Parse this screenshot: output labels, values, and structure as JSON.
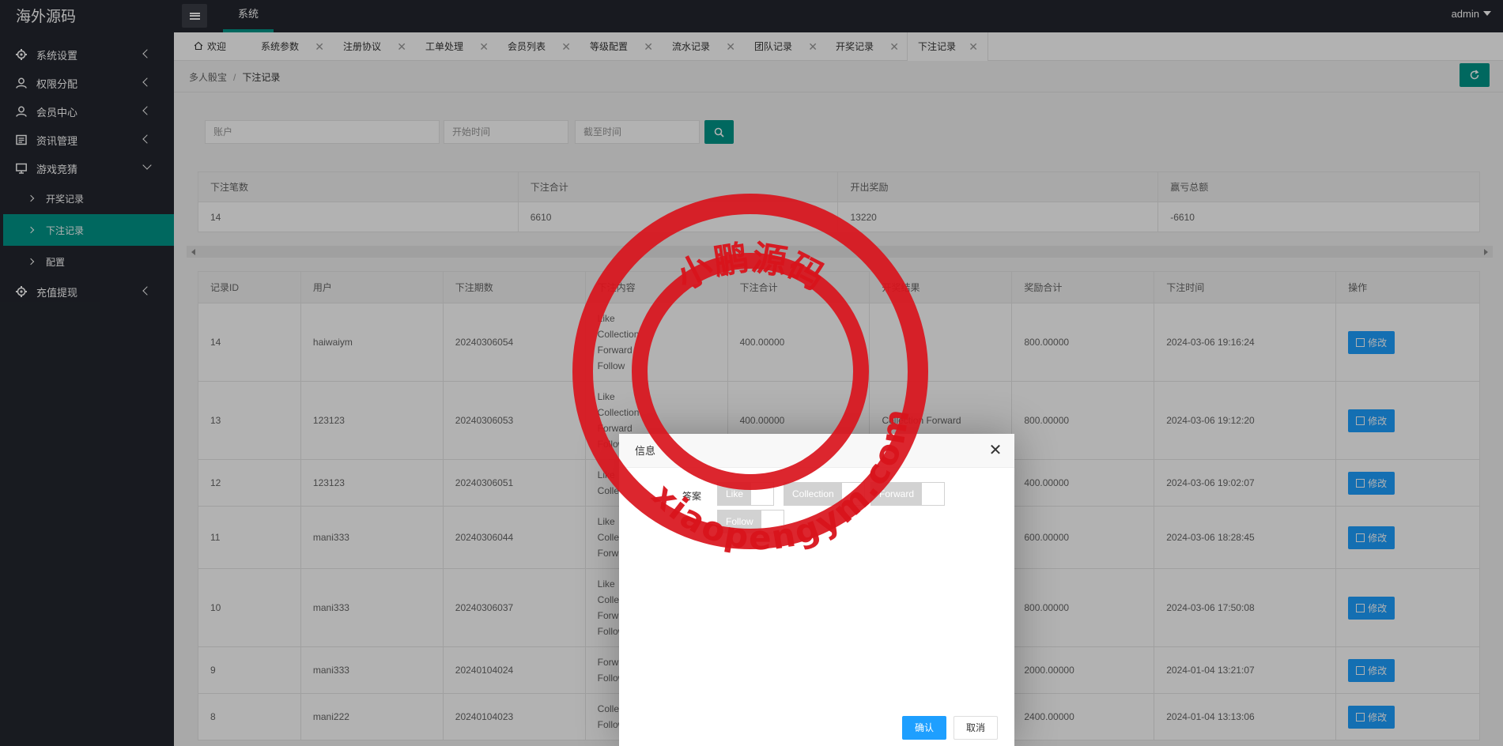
{
  "app": {
    "logo": "海外源码",
    "top_nav": "系统",
    "user": "admin"
  },
  "sidebar": {
    "items": [
      {
        "label": "系统设置",
        "icon": "gear-icon"
      },
      {
        "label": "权限分配",
        "icon": "user-key-icon"
      },
      {
        "label": "会员中心",
        "icon": "user-icon"
      },
      {
        "label": "资讯管理",
        "icon": "news-icon"
      },
      {
        "label": "游戏竞猜",
        "icon": "monitor-icon"
      },
      {
        "label": "充值提现",
        "icon": "gear-icon"
      }
    ],
    "sub_items": [
      {
        "label": "开奖记录"
      },
      {
        "label": "下注记录"
      },
      {
        "label": "配置"
      }
    ]
  },
  "tabs": [
    {
      "label": "欢迎"
    },
    {
      "label": "系统参数"
    },
    {
      "label": "注册协议"
    },
    {
      "label": "工单处理"
    },
    {
      "label": "会员列表"
    },
    {
      "label": "等级配置"
    },
    {
      "label": "流水记录"
    },
    {
      "label": "团队记录"
    },
    {
      "label": "开奖记录"
    },
    {
      "label": "下注记录"
    }
  ],
  "breadcrumb": {
    "parent": "多人骰宝",
    "sep": "/",
    "current": "下注记录"
  },
  "filters": {
    "account_placeholder": "账户",
    "start_placeholder": "开始时间",
    "end_placeholder": "截至时间"
  },
  "summary": {
    "headers": [
      "下注笔数",
      "下注合计",
      "开出奖励",
      "赢亏总额"
    ],
    "values": [
      "14",
      "6610",
      "13220",
      "-6610"
    ]
  },
  "table": {
    "headers": [
      "记录ID",
      "用户",
      "下注期数",
      "下注内容",
      "下注合计",
      "开奖结果",
      "奖励合计",
      "下注时间",
      "操作"
    ],
    "edit_label": "修改",
    "rows": [
      {
        "id": "14",
        "user": "haiwaiym",
        "period": "20240306054",
        "content": [
          "Like",
          "Collection",
          "Forward",
          "Follow"
        ],
        "total": "400.00000",
        "result": "",
        "reward": "800.00000",
        "time": "2024-03-06 19:16:24"
      },
      {
        "id": "13",
        "user": "123123",
        "period": "20240306053",
        "content": [
          "Like",
          "Collection",
          "Forward",
          "Follow"
        ],
        "total": "400.00000",
        "result": "Collection Forward",
        "reward": "800.00000",
        "time": "2024-03-06 19:12:20"
      },
      {
        "id": "12",
        "user": "123123",
        "period": "20240306051",
        "content": [
          "Like",
          "Collection"
        ],
        "total": "",
        "result": "",
        "reward": "400.00000",
        "time": "2024-03-06 19:02:07"
      },
      {
        "id": "11",
        "user": "mani333",
        "period": "20240306044",
        "content": [
          "Like",
          "Collection",
          "Forward"
        ],
        "total": "",
        "result": "",
        "reward": "600.00000",
        "time": "2024-03-06 18:28:45"
      },
      {
        "id": "10",
        "user": "mani333",
        "period": "20240306037",
        "content": [
          "Like",
          "Collection",
          "Forward",
          "Follow"
        ],
        "total": "",
        "result": "",
        "reward": "800.00000",
        "time": "2024-03-06 17:50:08"
      },
      {
        "id": "9",
        "user": "mani333",
        "period": "20240104024",
        "content": [
          "Forward",
          "Follow"
        ],
        "total": "",
        "result": "",
        "reward": "2000.00000",
        "time": "2024-01-04 13:21:07"
      },
      {
        "id": "8",
        "user": "mani222",
        "period": "20240104023",
        "content": [
          "Collection",
          "Follow"
        ],
        "total": "",
        "result": "",
        "reward": "2400.00000",
        "time": "2024-01-04 13:13:06"
      }
    ]
  },
  "modal": {
    "title": "信息",
    "field_label": "答案",
    "options": [
      "Like",
      "Collection",
      "Forward",
      "Follow"
    ],
    "confirm": "确认",
    "cancel": "取消"
  },
  "watermark": {
    "top_text": "小鹏源码",
    "bottom_text": "xiaopengym.com",
    "color": "#d9141c"
  },
  "colors": {
    "primary": "#009688",
    "blue": "#1e9fff",
    "dark": "#23262e"
  }
}
